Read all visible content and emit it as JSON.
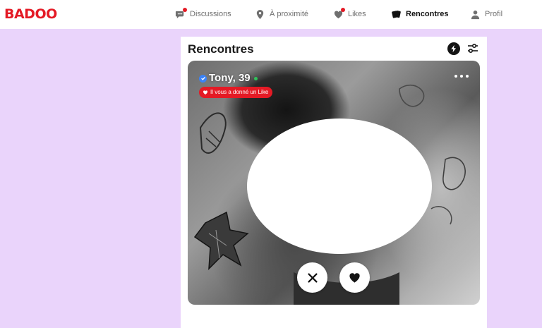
{
  "brand": {
    "logo": "BADOO",
    "color": "#e41a25"
  },
  "nav": {
    "items": [
      {
        "label": "Discussions",
        "icon": "chat-bubbles-icon",
        "has_dot": true
      },
      {
        "label": "À proximité",
        "icon": "location-pin-icon",
        "has_dot": false
      },
      {
        "label": "Likes",
        "icon": "heart-icon",
        "has_dot": true
      },
      {
        "label": "Rencontres",
        "icon": "cards-icon",
        "has_dot": false,
        "active": true
      },
      {
        "label": "Profil",
        "icon": "person-icon",
        "has_dot": false
      }
    ]
  },
  "page": {
    "title": "Rencontres",
    "boost_icon": "lightning-icon",
    "filter_icon": "sliders-icon"
  },
  "profile": {
    "name_age": "Tony, 39",
    "verified": true,
    "online": true,
    "like_badge": "Il vous a donné un Like",
    "more_icon": "more-dots-icon",
    "pass_icon": "close-icon",
    "like_icon": "heart-icon"
  },
  "colors": {
    "background": "#ead4fb",
    "accent": "#e41a25",
    "online": "#30c25a",
    "verified": "#3b82f6"
  }
}
